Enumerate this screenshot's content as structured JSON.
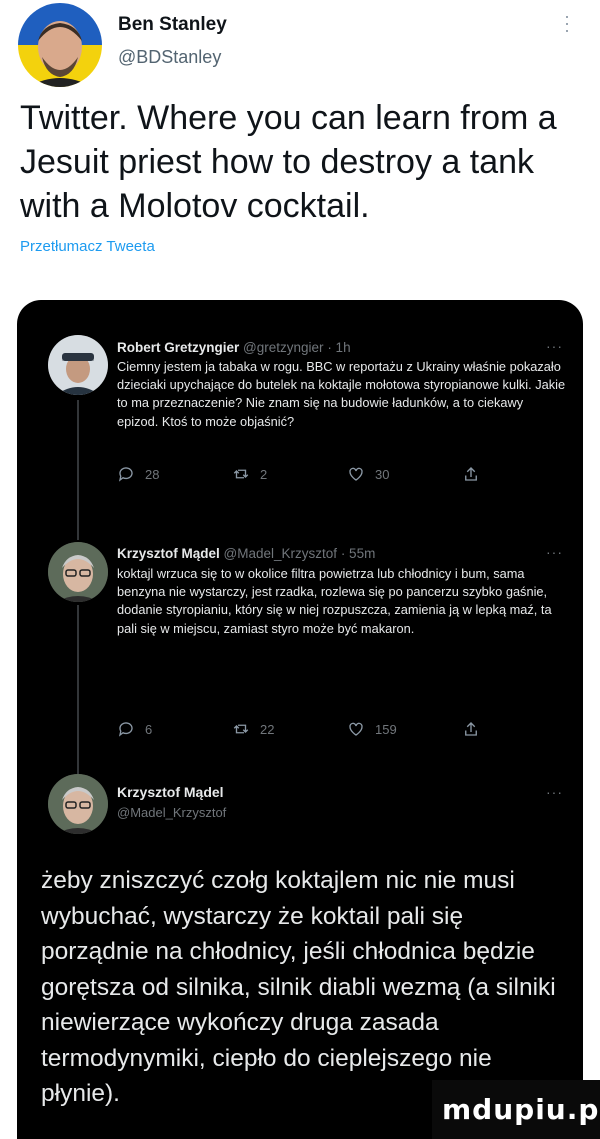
{
  "outer_tweet": {
    "name": "Ben Stanley",
    "handle": "@BDStanley",
    "text": "Twitter. Where you can learn from a Jesuit priest how to destroy a tank with a Molotov cocktail.",
    "translate": "Przetłumacz Tweeta",
    "more_icon": "more-vertical-icon"
  },
  "thread": [
    {
      "name": "Robert Gretzyngier",
      "handle": "@gretzyngier",
      "time": "· 1h",
      "text": "Ciemny jestem ja tabaka w rogu. BBC w reportażu z Ukrainy właśnie pokazało dzieciaki upychające do butelek na koktajle mołotowa styropianowe kulki. Jakie to ma przeznaczenie? Nie znam się na budowie ładunków, a to ciekawy epizod. Ktoś to może objaśnić?",
      "replies": "28",
      "retweets": "2",
      "likes": "30"
    },
    {
      "name": "Krzysztof Mądel",
      "handle": "@Madel_Krzysztof",
      "time": "· 55m",
      "text": "koktajl wrzuca się to w okolice filtra powietrza lub chłodnicy i bum, sama benzyna nie wystarczy, jest rzadka, rozlewa się po pancerzu szybko gaśnie, dodanie styropianiu, który się w niej rozpuszcza, zamienia ją w lepką maź, ta pali się w miejscu, zamiast styro może być makaron.",
      "replies": "6",
      "retweets": "22",
      "likes": "159"
    }
  ],
  "main_tweet": {
    "name": "Krzysztof Mądel",
    "handle": "@Madel_Krzysztof",
    "text": "żeby zniszczyć czołg koktajlem nic nie musi wybuchać, wystarczy że koktail pali się porządnie na chłodnicy, jeśli chłodnica będzie gorętsza od silnika, silnik diabli wezmą (a silniki niewierzące wykończy druga zasada termodynymiki, ciepło do cieplejszego nie płynie)."
  },
  "more_label": "···",
  "watermark": "mdupiu.pl",
  "colors": {
    "accent": "#1d9bf0",
    "dark_bg": "#000000",
    "muted": "#71767b"
  }
}
